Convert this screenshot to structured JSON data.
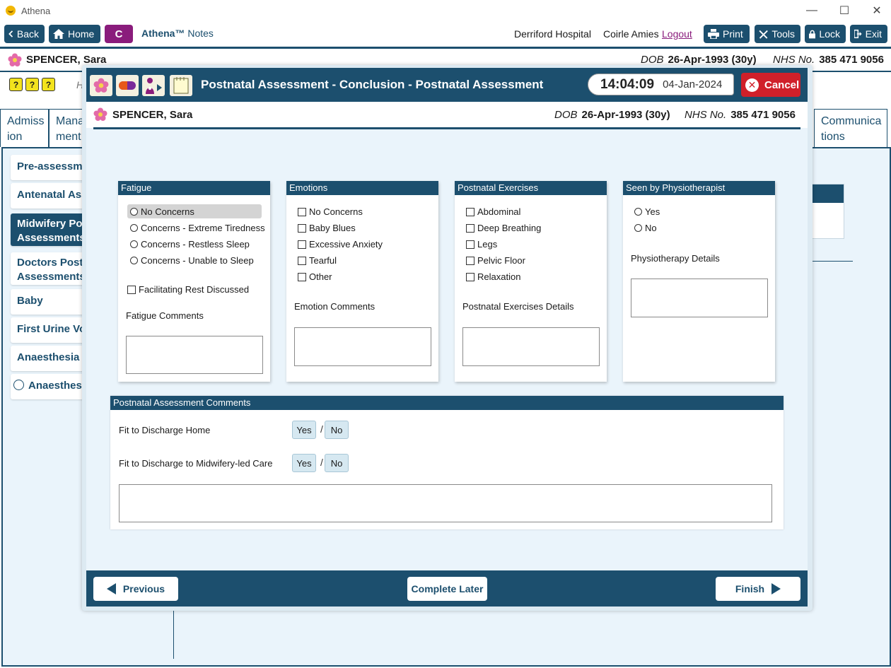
{
  "window": {
    "title": "Athena",
    "minimize": "—",
    "maximize": "☐",
    "close": "✕"
  },
  "toolbar": {
    "back": "Back",
    "home": "Home",
    "c": "C",
    "app_name": "Athena™",
    "app_module": "Notes",
    "hospital": "Derriford Hospital",
    "user": "Coirle Amies",
    "logout": "Logout",
    "print": "Print",
    "tools": "Tools",
    "lock": "Lock",
    "exit": "Exit"
  },
  "patient": {
    "name": "SPENCER, Sara",
    "dob_label": "DOB",
    "dob": "26-Apr-1993 (30y)",
    "nhs_label": "NHS No.",
    "nhs": "385 471 9056"
  },
  "background": {
    "alerts": [
      "?",
      "?",
      "?"
    ],
    "hint": "H",
    "tabs": [
      {
        "label_line1": "Admiss",
        "label_line2": "ion"
      },
      {
        "label_line1": "Mana",
        "label_line2": "ment"
      },
      {
        "label_line1": "Communica",
        "label_line2": "tions"
      }
    ],
    "nav": [
      {
        "label": "Pre-assessment"
      },
      {
        "label": "Antenatal Assessments"
      },
      {
        "label_line1": "Midwifery Postnatal",
        "label_line2": "Assessments"
      },
      {
        "label_line1": "Doctors Postnatal",
        "label_line2": "Assessments"
      },
      {
        "label": "Baby"
      },
      {
        "label": "First Urine Void"
      },
      {
        "label": "Anaesthesia Information"
      },
      {
        "label": "Anaesthesia"
      }
    ]
  },
  "modal": {
    "title": "Postnatal Assessment - Conclusion - Postnatal Assessment",
    "time": "14:04:09",
    "date": "04-Jan-2024",
    "cancel": "Cancel",
    "fatigue": {
      "header": "Fatigue",
      "options": [
        "No Concerns",
        "Concerns - Extreme Tiredness",
        "Concerns - Restless Sleep",
        "Concerns - Unable to Sleep"
      ],
      "selected": "No Concerns",
      "rest_checkbox": "Facilitating Rest Discussed",
      "comments_label": "Fatigue Comments",
      "comments_value": ""
    },
    "emotions": {
      "header": "Emotions",
      "options": [
        "No Concerns",
        "Baby Blues",
        "Excessive Anxiety",
        "Tearful",
        "Other"
      ],
      "comments_label": "Emotion Comments",
      "comments_value": ""
    },
    "exercises": {
      "header": "Postnatal Exercises",
      "options": [
        "Abdominal",
        "Deep Breathing",
        "Legs",
        "Pelvic Floor",
        "Relaxation"
      ],
      "details_label": "Postnatal Exercises Details",
      "details_value": ""
    },
    "physio": {
      "header": "Seen by Physiotherapist",
      "options": [
        "Yes",
        "No"
      ],
      "details_label": "Physiotherapy Details",
      "details_value": ""
    },
    "comments": {
      "header": "Postnatal Assessment Comments",
      "discharge_home_label": "Fit to Discharge Home",
      "discharge_mlc_label": "Fit to Discharge to Midwifery-led Care",
      "yes": "Yes",
      "no": "No",
      "slash": "/",
      "text_value": ""
    },
    "footer": {
      "previous": "Previous",
      "complete_later": "Complete Later",
      "finish": "Finish"
    }
  },
  "colors": {
    "primary": "#1c4f6e",
    "accent": "#8a1c7c",
    "cancel": "#d0202a",
    "panel_bg": "#eaf4fb"
  }
}
